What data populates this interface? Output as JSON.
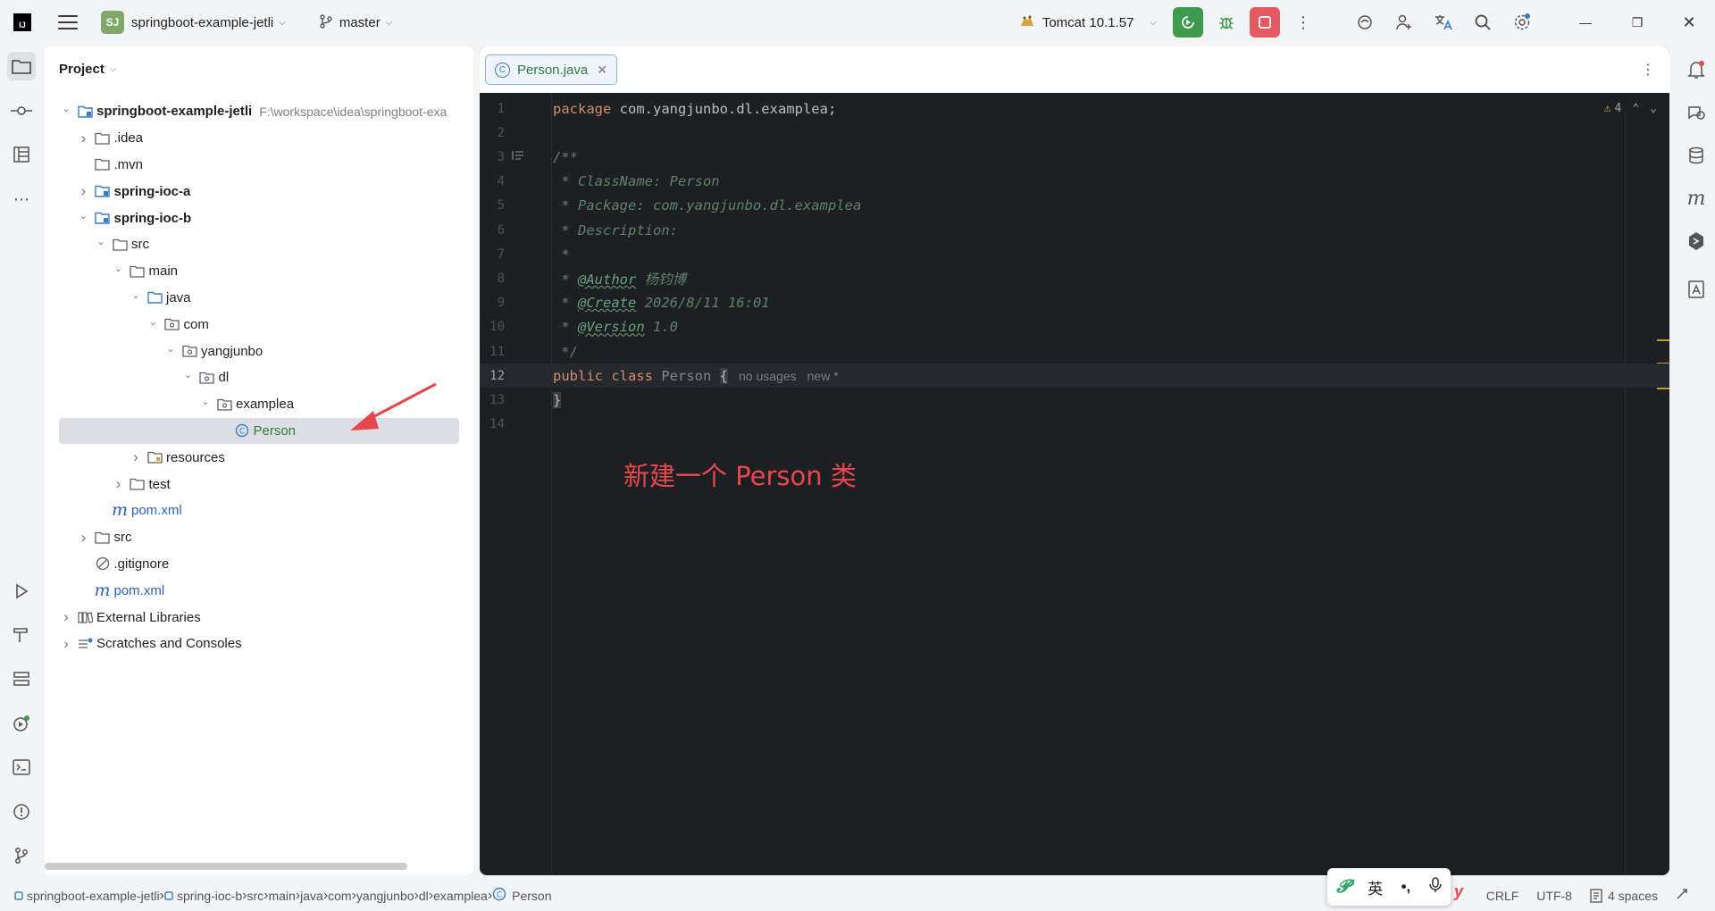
{
  "titlebar": {
    "logo_text": "IJ",
    "project_badge": "SJ",
    "project_name": "springboot-example-jetli",
    "branch": "master",
    "run_config": "Tomcat 10.1.57"
  },
  "sidebar_tree": {
    "header": "Project",
    "rows": [
      {
        "label": "springboot-example-jetli",
        "path": "F:\\workspace\\idea\\springboot-exa",
        "indent": 0,
        "arrow": "open",
        "icon": "module",
        "style": "bold"
      },
      {
        "label": ".idea",
        "indent": 1,
        "arrow": "closed",
        "icon": "folder",
        "style": "normal"
      },
      {
        "label": ".mvn",
        "indent": 1,
        "arrow": "none",
        "icon": "folder",
        "style": "normal"
      },
      {
        "label": "spring-ioc-a",
        "indent": 1,
        "arrow": "closed",
        "icon": "module",
        "style": "bold"
      },
      {
        "label": "spring-ioc-b",
        "indent": 1,
        "arrow": "open",
        "icon": "module",
        "style": "bold"
      },
      {
        "label": "src",
        "indent": 2,
        "arrow": "open",
        "icon": "folder",
        "style": "normal"
      },
      {
        "label": "main",
        "indent": 3,
        "arrow": "open",
        "icon": "folder",
        "style": "normal"
      },
      {
        "label": "java",
        "indent": 4,
        "arrow": "open",
        "icon": "folder-blue",
        "style": "normal"
      },
      {
        "label": "com",
        "indent": 5,
        "arrow": "open",
        "icon": "package",
        "style": "normal"
      },
      {
        "label": "yangjunbo",
        "indent": 6,
        "arrow": "open",
        "icon": "package",
        "style": "normal"
      },
      {
        "label": "dl",
        "indent": 7,
        "arrow": "open",
        "icon": "package",
        "style": "normal"
      },
      {
        "label": "examplea",
        "indent": 8,
        "arrow": "open",
        "icon": "package",
        "style": "normal"
      },
      {
        "label": "Person",
        "indent": 9,
        "arrow": "none",
        "icon": "class",
        "style": "green",
        "selected": true
      },
      {
        "label": "resources",
        "indent": 4,
        "arrow": "closed",
        "icon": "folder-res",
        "style": "normal"
      },
      {
        "label": "test",
        "indent": 3,
        "arrow": "closed",
        "icon": "folder",
        "style": "normal"
      },
      {
        "label": "pom.xml",
        "indent": 2,
        "arrow": "none",
        "icon": "maven",
        "style": "blue"
      },
      {
        "label": "src",
        "indent": 1,
        "arrow": "closed",
        "icon": "folder",
        "style": "normal"
      },
      {
        "label": ".gitignore",
        "indent": 1,
        "arrow": "none",
        "icon": "ignore",
        "style": "normal"
      },
      {
        "label": "pom.xml",
        "indent": 1,
        "arrow": "none",
        "icon": "maven",
        "style": "blue"
      },
      {
        "label": "External Libraries",
        "indent": 0,
        "arrow": "closed",
        "icon": "libs",
        "style": "normal"
      },
      {
        "label": "Scratches and Consoles",
        "indent": 0,
        "arrow": "closed",
        "icon": "scratch",
        "style": "normal"
      }
    ]
  },
  "editor": {
    "tab_label": "Person.java",
    "inspection_count": "4",
    "lines": [
      {
        "n": "1",
        "html": "<span class='kw'>package</span> <span class='pkg'>com.yangjunbo.dl.examplea;</span>"
      },
      {
        "n": "2",
        "html": ""
      },
      {
        "n": "3",
        "html": "<span class='doc'>/**</span>",
        "fold": true
      },
      {
        "n": "4",
        "html": "<span class='doc'> * ClassName: Person</span>"
      },
      {
        "n": "5",
        "html": "<span class='doc'> * Package: com.yangjunbo.dl.examplea</span>"
      },
      {
        "n": "6",
        "html": "<span class='doc'> * Description:</span>"
      },
      {
        "n": "7",
        "html": "<span class='doc'> *</span>"
      },
      {
        "n": "8",
        "html": "<span class='doc'> * </span><span class='tag'>@Author</span><span class='doc'> 杨钧博</span>"
      },
      {
        "n": "9",
        "html": "<span class='doc'> * </span><span class='tag'>@Create</span><span class='doc'> 2026/8/11 16:01</span>"
      },
      {
        "n": "10",
        "html": "<span class='doc'> * </span><span class='tag'>@Version</span><span class='doc'> 1.0</span>"
      },
      {
        "n": "11",
        "html": "<span class='doc'> */</span>"
      },
      {
        "n": "12",
        "html": "<span class='kw'>public class</span> <span class='cls'>Person</span> <span class='brace'>{</span><span class='hint'>no usages</span><span class='hint'>new *</span>",
        "current": true
      },
      {
        "n": "13",
        "html": "<span class='brace'>}</span>"
      },
      {
        "n": "14",
        "html": ""
      }
    ],
    "annotation": "新建一个 Person 类"
  },
  "statusbar": {
    "breadcrumbs": [
      "springboot-example-jetli",
      "spring-ioc-b",
      "src",
      "main",
      "java",
      "com",
      "yangjunbo",
      "dl",
      "examplea",
      "Person"
    ],
    "line_sep": "CRLF",
    "encoding": "UTF-8",
    "indent": "4 spaces"
  },
  "ime": {
    "lang": "英",
    "punct": "•,"
  },
  "colors": {
    "accent_green": "#3d9a4f",
    "stop_red": "#e55a60",
    "annotation_red": "#e5484d",
    "editor_bg": "#1e1f22"
  }
}
